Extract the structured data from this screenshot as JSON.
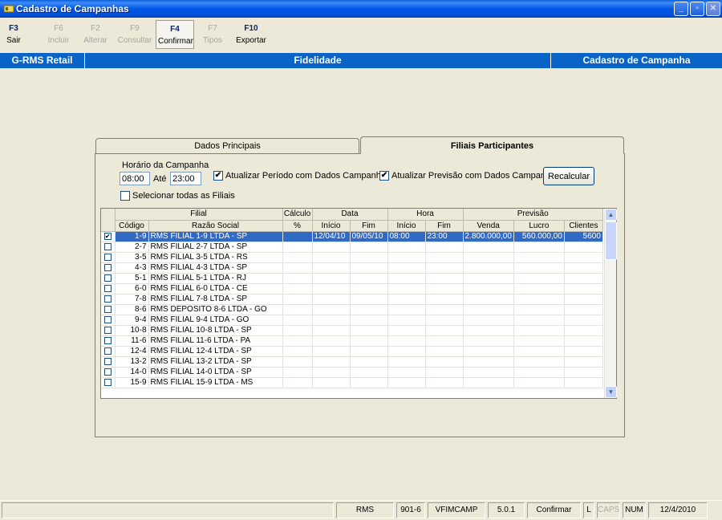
{
  "window": {
    "title": "Cadastro de Campanhas"
  },
  "toolbar": [
    {
      "key": "F3",
      "label": "Sair",
      "enabled": true
    },
    {
      "key": "F6",
      "label": "Incluir",
      "enabled": false
    },
    {
      "key": "F2",
      "label": "Alterar",
      "enabled": false
    },
    {
      "key": "F9",
      "label": "Consultar",
      "enabled": false
    },
    {
      "key": "F4",
      "label": "Confirmar",
      "enabled": true
    },
    {
      "key": "F7",
      "label": "Tipos",
      "enabled": false
    },
    {
      "key": "F10",
      "label": "Exportar",
      "enabled": true
    }
  ],
  "module_bar": {
    "left": "G-RMS Retail",
    "center": "Fidelidade",
    "right": "Cadastro de Campanha"
  },
  "tabs": {
    "tab1": "Dados Principais",
    "tab2": "Filiais Participantes"
  },
  "form": {
    "horario_label": "Horário da Campanha",
    "start_time": "08:00",
    "ate_label": "Até",
    "end_time": "23:00",
    "chk_periodo_label": "Atualizar Período com Dados Campanha",
    "chk_periodo_checked": true,
    "chk_previsao_label": "Atualizar Previsão com Dados Campanha",
    "chk_previsao_checked": true,
    "recalcular_label": "Recalcular",
    "select_all_label": "Selecionar todas as Filiais",
    "select_all_checked": false
  },
  "grid": {
    "group_headers": {
      "filial": "Filial",
      "calculo": "Cálculo",
      "data": "Data",
      "hora": "Hora",
      "previsao": "Previsão"
    },
    "columns": {
      "codigo": "Código",
      "razao": "Razão Social",
      "pct": "%",
      "data_ini": "Início",
      "data_fim": "Fim",
      "hora_ini": "Início",
      "hora_fim": "Fim",
      "venda": "Venda",
      "lucro": "Lucro",
      "clientes": "Clientes"
    },
    "rows": [
      {
        "checked": "✔",
        "codigo": "1-9",
        "razao": "RMS FILIAL 1-9 LTDA - SP",
        "pct": "",
        "data_ini": "12/04/10",
        "data_fim": "09/05/10",
        "hora_ini": "08:00",
        "hora_fim": "23:00",
        "venda": "2.800.000,00",
        "lucro": "560.000,00",
        "clientes": "5600"
      },
      {
        "checked": "",
        "codigo": "2-7",
        "razao": "RMS FILIAL 2-7 LTDA - SP",
        "pct": "",
        "data_ini": "",
        "data_fim": "",
        "hora_ini": "",
        "hora_fim": "",
        "venda": "",
        "lucro": "",
        "clientes": ""
      },
      {
        "checked": "",
        "codigo": "3-5",
        "razao": "RMS FILIAL 3-5 LTDA - RS",
        "pct": "",
        "data_ini": "",
        "data_fim": "",
        "hora_ini": "",
        "hora_fim": "",
        "venda": "",
        "lucro": "",
        "clientes": ""
      },
      {
        "checked": "",
        "codigo": "4-3",
        "razao": "RMS FILIAL 4-3 LTDA - SP",
        "pct": "",
        "data_ini": "",
        "data_fim": "",
        "hora_ini": "",
        "hora_fim": "",
        "venda": "",
        "lucro": "",
        "clientes": ""
      },
      {
        "checked": "",
        "codigo": "5-1",
        "razao": "RMS FILIAL 5-1 LTDA - RJ",
        "pct": "",
        "data_ini": "",
        "data_fim": "",
        "hora_ini": "",
        "hora_fim": "",
        "venda": "",
        "lucro": "",
        "clientes": ""
      },
      {
        "checked": "",
        "codigo": "6-0",
        "razao": "RMS FILIAL 6-0 LTDA - CE",
        "pct": "",
        "data_ini": "",
        "data_fim": "",
        "hora_ini": "",
        "hora_fim": "",
        "venda": "",
        "lucro": "",
        "clientes": ""
      },
      {
        "checked": "",
        "codigo": "7-8",
        "razao": "RMS FILIAL 7-8 LTDA - SP",
        "pct": "",
        "data_ini": "",
        "data_fim": "",
        "hora_ini": "",
        "hora_fim": "",
        "venda": "",
        "lucro": "",
        "clientes": ""
      },
      {
        "checked": "",
        "codigo": "8-6",
        "razao": "RMS DEPOSITO 8-6 LTDA - GO",
        "pct": "",
        "data_ini": "",
        "data_fim": "",
        "hora_ini": "",
        "hora_fim": "",
        "venda": "",
        "lucro": "",
        "clientes": ""
      },
      {
        "checked": "",
        "codigo": "9-4",
        "razao": "RMS FILIAL 9-4 LTDA - GO",
        "pct": "",
        "data_ini": "",
        "data_fim": "",
        "hora_ini": "",
        "hora_fim": "",
        "venda": "",
        "lucro": "",
        "clientes": ""
      },
      {
        "checked": "",
        "codigo": "10-8",
        "razao": "RMS FILIAL 10-8 LTDA - SP",
        "pct": "",
        "data_ini": "",
        "data_fim": "",
        "hora_ini": "",
        "hora_fim": "",
        "venda": "",
        "lucro": "",
        "clientes": ""
      },
      {
        "checked": "",
        "codigo": "11-6",
        "razao": "RMS FILIAL 11-6 LTDA - PA",
        "pct": "",
        "data_ini": "",
        "data_fim": "",
        "hora_ini": "",
        "hora_fim": "",
        "venda": "",
        "lucro": "",
        "clientes": ""
      },
      {
        "checked": "",
        "codigo": "12-4",
        "razao": "RMS FILIAL 12-4 LTDA - SP",
        "pct": "",
        "data_ini": "",
        "data_fim": "",
        "hora_ini": "",
        "hora_fim": "",
        "venda": "",
        "lucro": "",
        "clientes": ""
      },
      {
        "checked": "",
        "codigo": "13-2",
        "razao": "RMS FILIAL 13-2 LTDA - SP",
        "pct": "",
        "data_ini": "",
        "data_fim": "",
        "hora_ini": "",
        "hora_fim": "",
        "venda": "",
        "lucro": "",
        "clientes": ""
      },
      {
        "checked": "",
        "codigo": "14-0",
        "razao": "RMS FILIAL 14-0 LTDA - SP",
        "pct": "",
        "data_ini": "",
        "data_fim": "",
        "hora_ini": "",
        "hora_fim": "",
        "venda": "",
        "lucro": "",
        "clientes": ""
      },
      {
        "checked": "",
        "codigo": "15-9",
        "razao": "RMS FILIAL 15-9 LTDA - MS",
        "pct": "",
        "data_ini": "",
        "data_fim": "",
        "hora_ini": "",
        "hora_fim": "",
        "venda": "",
        "lucro": "",
        "clientes": ""
      }
    ]
  },
  "statusbar": {
    "system": "RMS",
    "code": "901-6",
    "program": "VFIMCAMP",
    "version": "5.0.1",
    "action": "Confirmar",
    "l": "L",
    "caps": "CAPS",
    "num": "NUM",
    "date": "12/4/2010"
  },
  "colors": {
    "accent": "#0a64c8",
    "selection": "#316ac5",
    "titlebar": "#0058e6"
  }
}
